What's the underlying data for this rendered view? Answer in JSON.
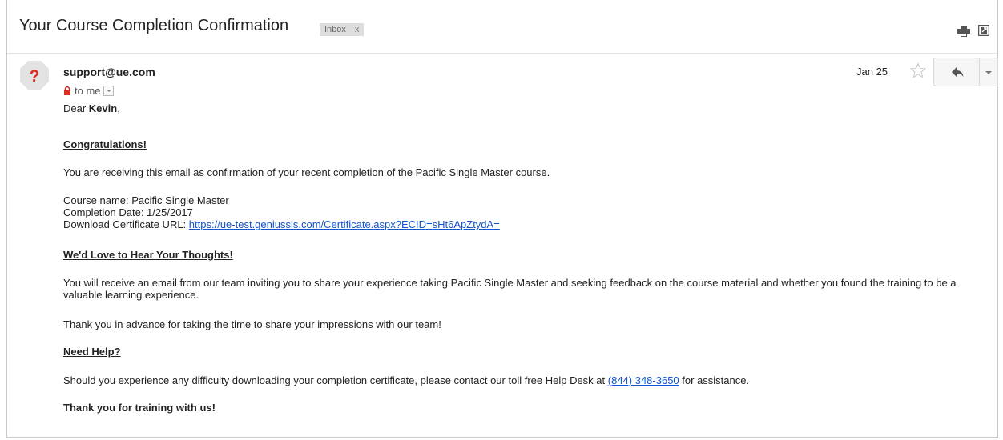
{
  "email": {
    "subject": "Your Course Completion Confirmation",
    "label": "Inbox",
    "label_remove": "x",
    "sender": "support@ue.com",
    "recipient": "to me",
    "date": "Jan 25",
    "greeting_prefix": "Dear ",
    "greeting_name": "Kevin",
    "greeting_suffix": ",",
    "congrats": "Congratulations!",
    "intro": "You are receiving this email as confirmation of your recent completion of the Pacific Single Master course.",
    "course_name": "Course name: Pacific Single Master",
    "completion_date": "Completion Date: 1/25/2017",
    "download_label": "Download Certificate URL: ",
    "download_url": "https://ue-test.geniussis.com/Certificate.aspx?ECID=sHt6ApZtydA=",
    "thoughts_heading": "We'd Love to Hear Your Thoughts!",
    "thoughts_body": "You will receive an email from our team inviting you to share your experience taking Pacific Single Master and seeking feedback on the course material and whether you found the training to be a valuable learning experience.",
    "thanks_advance": "Thank you in advance for taking the time to share your impressions with our team!",
    "help_heading": "Need Help?",
    "help_body_prefix": "Should you experience any difficulty downloading your completion certificate, please contact our toll free Help Desk at ",
    "help_phone": "(844) 348-3650",
    "help_body_suffix": " for assistance.",
    "closing": "Thank you for training with us!"
  },
  "icons": {
    "print": "print-icon",
    "new_window": "new-window-icon",
    "avatar": "unknown-sender-avatar",
    "lock": "lock-icon",
    "star": "star-icon",
    "reply": "reply-icon",
    "more": "chevron-down-icon"
  },
  "colors": {
    "link": "#1155cc",
    "avatar_mark": "#d93025",
    "label_bg": "#dddddd"
  }
}
